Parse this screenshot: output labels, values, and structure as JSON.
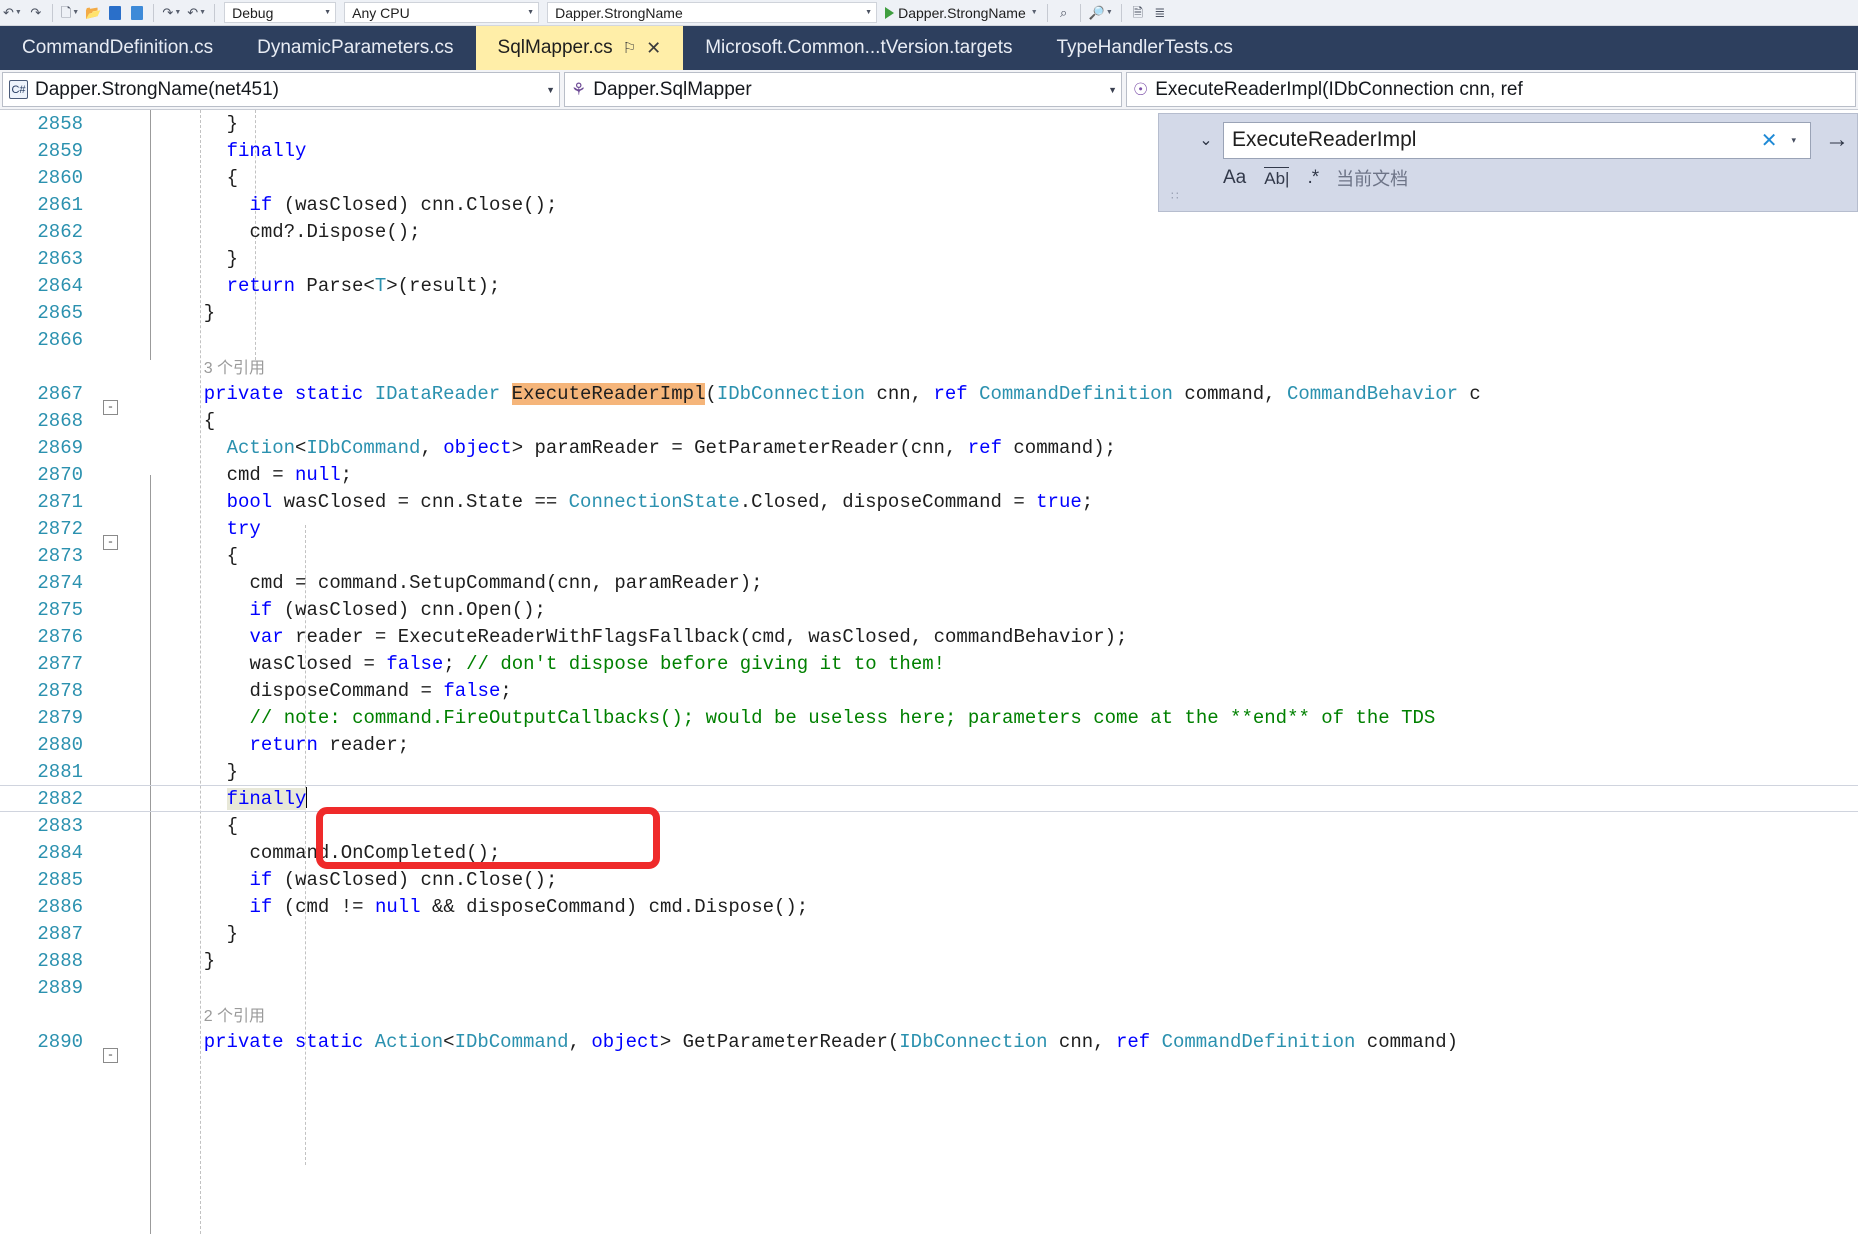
{
  "toolbar": {
    "config_value": "Debug",
    "platform_value": "Any CPU",
    "startup_value": "Dapper.StrongName",
    "run_label": "Dapper.StrongName",
    "icons": {
      "undo": "undo-icon",
      "redo": "redo-icon",
      "save": "save-icon",
      "save_all": "save-all-icon",
      "new_item": "new-item-icon",
      "open": "open-folder-icon",
      "nav_back": "nav-back-icon",
      "nav_forward": "nav-forward-icon",
      "find_in_files": "find-in-files-icon",
      "quick_launch": "quick-launch-icon",
      "comment": "comment-icon",
      "indent": "indent-icon"
    }
  },
  "tabs": [
    {
      "label": "CommandDefinition.cs",
      "active": false
    },
    {
      "label": "DynamicParameters.cs",
      "active": false
    },
    {
      "label": "SqlMapper.cs",
      "active": true,
      "pin": "⚐",
      "close": "✕"
    },
    {
      "label": "Microsoft.Common...tVersion.targets",
      "active": false
    },
    {
      "label": "TypeHandlerTests.cs",
      "active": false
    }
  ],
  "navbar": {
    "project": "Dapper.StrongName(net451)",
    "type": "Dapper.SqlMapper",
    "member": "ExecuteReaderImpl(IDbConnection cnn, ref",
    "caret": "▾",
    "project_icon": "csharp-project-icon",
    "type_icon": "class-icon",
    "member_icon": "method-icon"
  },
  "find": {
    "query": "ExecuteReaderImpl",
    "chevron": "⌄",
    "clear": "✕",
    "dropdown": "▾",
    "next": "→",
    "match_case": "Aa",
    "match_word": "Ab|",
    "use_regex": ".*",
    "scope": "当前文档"
  },
  "editor": {
    "lines": [
      {
        "n": "2858",
        "indent": 8,
        "tokens": [
          {
            "t": "}",
            "c": "pln"
          }
        ]
      },
      {
        "n": "2859",
        "indent": 8,
        "tokens": [
          {
            "t": "finally",
            "c": "kw"
          }
        ]
      },
      {
        "n": "2860",
        "indent": 8,
        "tokens": [
          {
            "t": "{",
            "c": "pln"
          }
        ]
      },
      {
        "n": "2861",
        "indent": 10,
        "tokens": [
          {
            "t": "if",
            "c": "kw"
          },
          {
            "t": " (wasClosed) cnn.Close();",
            "c": "pln"
          }
        ]
      },
      {
        "n": "2862",
        "indent": 10,
        "tokens": [
          {
            "t": "cmd?.Dispose();",
            "c": "pln"
          }
        ]
      },
      {
        "n": "2863",
        "indent": 8,
        "tokens": [
          {
            "t": "}",
            "c": "pln"
          }
        ]
      },
      {
        "n": "2864",
        "indent": 8,
        "tokens": [
          {
            "t": "return",
            "c": "kw"
          },
          {
            "t": " Parse<",
            "c": "pln"
          },
          {
            "t": "T",
            "c": "typ"
          },
          {
            "t": ">(result);",
            "c": "pln"
          }
        ]
      },
      {
        "n": "2865",
        "indent": 6,
        "tokens": [
          {
            "t": "}",
            "c": "pln"
          }
        ]
      },
      {
        "n": "2866",
        "indent": 0,
        "tokens": []
      },
      {
        "n": "",
        "indent": 6,
        "lens": "3 个引用"
      },
      {
        "n": "2867",
        "indent": 6,
        "fold": "-",
        "tokens": [
          {
            "t": "private static",
            "c": "kw"
          },
          {
            "t": " ",
            "c": "pln"
          },
          {
            "t": "IDataReader",
            "c": "typ"
          },
          {
            "t": " ",
            "c": "pln"
          },
          {
            "t": "ExecuteReaderImpl",
            "c": "hl"
          },
          {
            "t": "(",
            "c": "pln"
          },
          {
            "t": "IDbConnection",
            "c": "typ"
          },
          {
            "t": " cnn, ",
            "c": "pln"
          },
          {
            "t": "ref",
            "c": "kw"
          },
          {
            "t": " ",
            "c": "pln"
          },
          {
            "t": "CommandDefinition",
            "c": "typ"
          },
          {
            "t": " command, ",
            "c": "pln"
          },
          {
            "t": "CommandBehavior",
            "c": "typ"
          },
          {
            "t": " c",
            "c": "pln"
          }
        ]
      },
      {
        "n": "2868",
        "indent": 6,
        "tokens": [
          {
            "t": "{",
            "c": "pln"
          }
        ]
      },
      {
        "n": "2869",
        "indent": 8,
        "tokens": [
          {
            "t": "Action",
            "c": "typ"
          },
          {
            "t": "<",
            "c": "pln"
          },
          {
            "t": "IDbCommand",
            "c": "typ"
          },
          {
            "t": ", ",
            "c": "pln"
          },
          {
            "t": "object",
            "c": "kw"
          },
          {
            "t": "> paramReader = GetParameterReader(cnn, ",
            "c": "pln"
          },
          {
            "t": "ref",
            "c": "kw"
          },
          {
            "t": " command);",
            "c": "pln"
          }
        ]
      },
      {
        "n": "2870",
        "indent": 8,
        "tokens": [
          {
            "t": "cmd = ",
            "c": "pln"
          },
          {
            "t": "null",
            "c": "kw"
          },
          {
            "t": ";",
            "c": "pln"
          }
        ]
      },
      {
        "n": "2871",
        "indent": 8,
        "tokens": [
          {
            "t": "bool",
            "c": "kw"
          },
          {
            "t": " wasClosed = cnn.State == ",
            "c": "pln"
          },
          {
            "t": "ConnectionState",
            "c": "typ"
          },
          {
            "t": ".Closed, disposeCommand = ",
            "c": "pln"
          },
          {
            "t": "true",
            "c": "kw"
          },
          {
            "t": ";",
            "c": "pln"
          }
        ]
      },
      {
        "n": "2872",
        "indent": 8,
        "fold": "-",
        "tokens": [
          {
            "t": "try",
            "c": "kw"
          }
        ]
      },
      {
        "n": "2873",
        "indent": 8,
        "tokens": [
          {
            "t": "{",
            "c": "pln"
          }
        ]
      },
      {
        "n": "2874",
        "indent": 10,
        "tokens": [
          {
            "t": "cmd = command.SetupCommand(cnn, paramReader);",
            "c": "pln"
          }
        ]
      },
      {
        "n": "2875",
        "indent": 10,
        "tokens": [
          {
            "t": "if",
            "c": "kw"
          },
          {
            "t": " (wasClosed) cnn.Open();",
            "c": "pln"
          }
        ]
      },
      {
        "n": "2876",
        "indent": 10,
        "tokens": [
          {
            "t": "var",
            "c": "kw"
          },
          {
            "t": " reader = ExecuteReaderWithFlagsFallback(cmd, wasClosed, commandBehavior);",
            "c": "pln"
          }
        ]
      },
      {
        "n": "2877",
        "indent": 10,
        "tokens": [
          {
            "t": "wasClosed = ",
            "c": "pln"
          },
          {
            "t": "false",
            "c": "kw"
          },
          {
            "t": "; ",
            "c": "pln"
          },
          {
            "t": "// don't dispose before giving it to them!",
            "c": "cmt"
          }
        ]
      },
      {
        "n": "2878",
        "indent": 10,
        "tokens": [
          {
            "t": "disposeCommand = ",
            "c": "pln"
          },
          {
            "t": "false",
            "c": "kw"
          },
          {
            "t": ";",
            "c": "pln"
          }
        ]
      },
      {
        "n": "2879",
        "indent": 10,
        "tokens": [
          {
            "t": "// note: command.FireOutputCallbacks(); would be useless here; parameters come at the **end** of the TDS",
            "c": "cmt"
          }
        ]
      },
      {
        "n": "2880",
        "indent": 10,
        "tokens": [
          {
            "t": "return",
            "c": "kw"
          },
          {
            "t": " reader;",
            "c": "pln"
          }
        ]
      },
      {
        "n": "2881",
        "indent": 8,
        "tokens": [
          {
            "t": "}",
            "c": "pln"
          }
        ]
      },
      {
        "n": "2882",
        "indent": 8,
        "current": true,
        "tokens": [
          {
            "t": "finally",
            "c": "kw",
            "cur": true
          }
        ],
        "caret": true
      },
      {
        "n": "2883",
        "indent": 8,
        "tokens": [
          {
            "t": "{",
            "c": "pln"
          }
        ]
      },
      {
        "n": "2884",
        "indent": 10,
        "tokens": [
          {
            "t": "command.OnCompleted();",
            "c": "pln"
          }
        ]
      },
      {
        "n": "2885",
        "indent": 10,
        "tokens": [
          {
            "t": "if",
            "c": "kw"
          },
          {
            "t": " (wasClosed) cnn.Close();",
            "c": "pln"
          }
        ]
      },
      {
        "n": "2886",
        "indent": 10,
        "tokens": [
          {
            "t": "if",
            "c": "kw"
          },
          {
            "t": " (cmd != ",
            "c": "pln"
          },
          {
            "t": "null",
            "c": "kw"
          },
          {
            "t": " && disposeCommand) cmd.Dispose();",
            "c": "pln"
          }
        ]
      },
      {
        "n": "2887",
        "indent": 8,
        "tokens": [
          {
            "t": "}",
            "c": "pln"
          }
        ]
      },
      {
        "n": "2888",
        "indent": 6,
        "tokens": [
          {
            "t": "}",
            "c": "pln"
          }
        ]
      },
      {
        "n": "2889",
        "indent": 0,
        "tokens": []
      },
      {
        "n": "",
        "indent": 6,
        "lens": "2 个引用"
      },
      {
        "n": "2890",
        "indent": 6,
        "fold": "-",
        "tokens": [
          {
            "t": "private static",
            "c": "kw"
          },
          {
            "t": " ",
            "c": "pln"
          },
          {
            "t": "Action",
            "c": "typ"
          },
          {
            "t": "<",
            "c": "pln"
          },
          {
            "t": "IDbCommand",
            "c": "typ"
          },
          {
            "t": ", ",
            "c": "pln"
          },
          {
            "t": "object",
            "c": "kw"
          },
          {
            "t": "> GetParameterReader(",
            "c": "pln"
          },
          {
            "t": "IDbConnection",
            "c": "typ"
          },
          {
            "t": " cnn, ",
            "c": "pln"
          },
          {
            "t": "ref",
            "c": "kw"
          },
          {
            "t": " ",
            "c": "pln"
          },
          {
            "t": "CommandDefinition",
            "c": "typ"
          },
          {
            "t": " command)",
            "c": "pln"
          }
        ]
      }
    ]
  },
  "colors": {
    "tabstrip_bg": "#2d3f5e",
    "active_tab_bg": "#ffeea8",
    "keyword": "#0000ff",
    "type": "#2b91af",
    "comment": "#008000",
    "linenumber": "#2b91af",
    "highlight": "#f5b57a",
    "annotation": "#ef2a2a",
    "find_bg": "#d3d9e8"
  }
}
